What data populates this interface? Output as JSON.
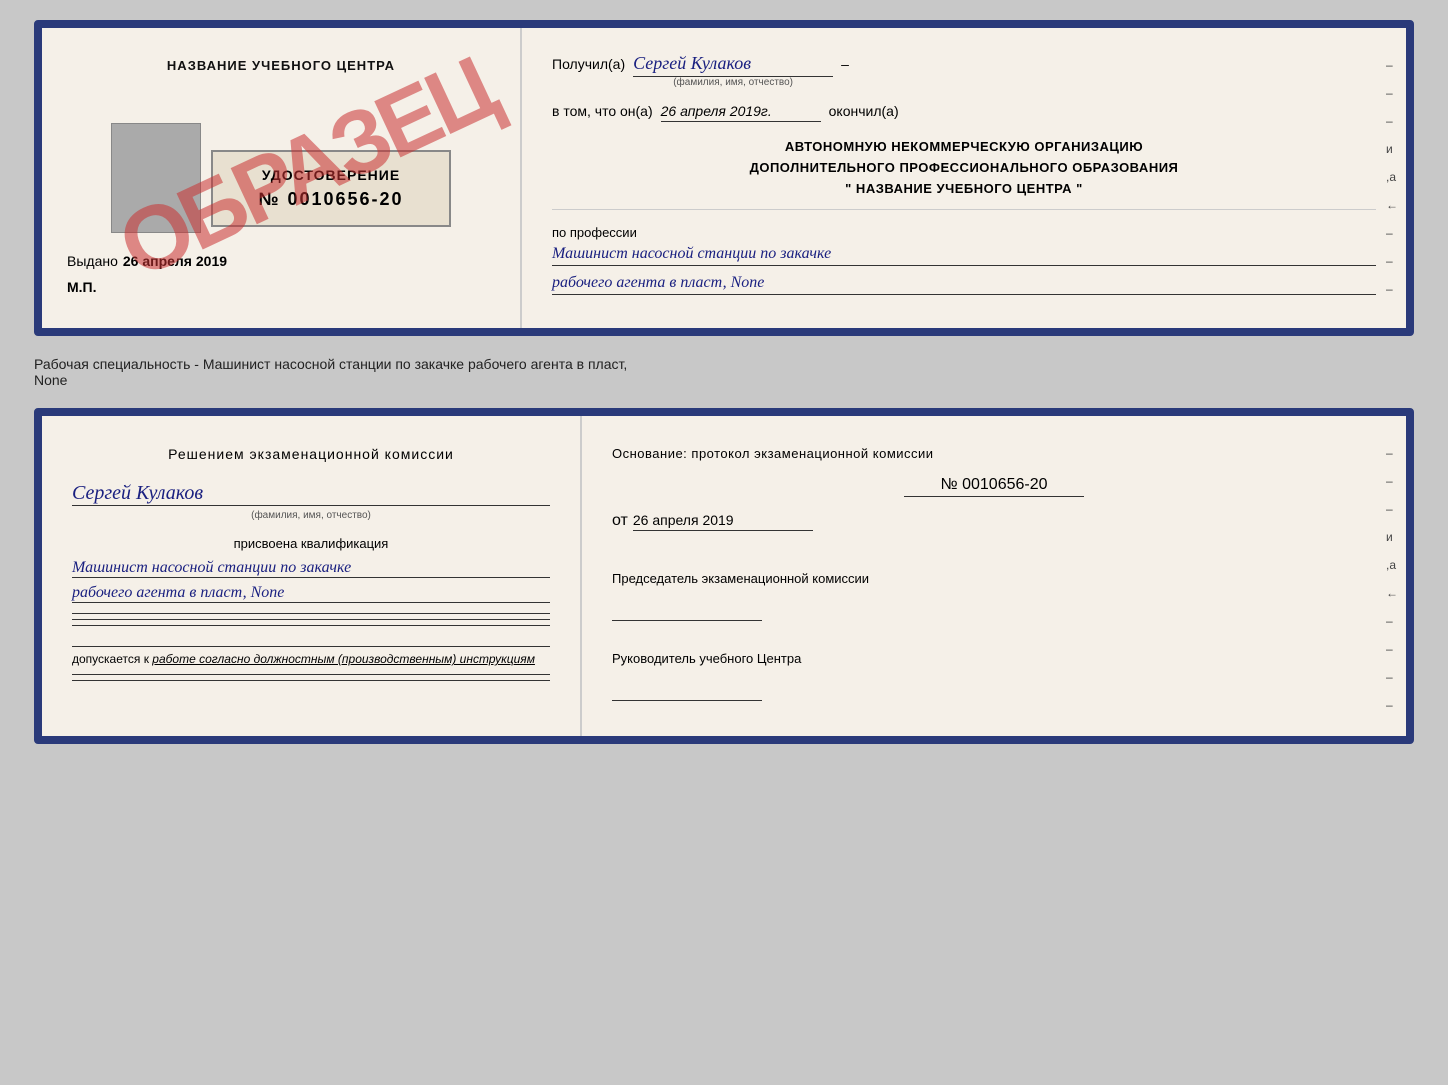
{
  "page": {
    "background": "#c8c8c8"
  },
  "card1": {
    "left": {
      "center_title": "НАЗВАНИЕ УЧЕБНОГО ЦЕНТРА",
      "stamp_text": "ОБРАЗЕЦ",
      "udost_label": "УДОСТОВЕРЕНИЕ",
      "udost_number": "№ 0010656-20",
      "vydano_label": "Выдано",
      "vydano_date": "26 апреля 2019",
      "mp_label": "М.П."
    },
    "right": {
      "poluchil_label": "Получил(а)",
      "poluchil_name": "Сергей Кулаков",
      "fio_hint": "(фамилия, имя, отчество)",
      "dash": "–",
      "vtom_label": "в том, что он(а)",
      "vtom_date": "26 апреля 2019г.",
      "okonchil_label": "окончил(а)",
      "org_line1": "АВТОНОМНУЮ НЕКОММЕРЧЕСКУЮ ОРГАНИЗАЦИЮ",
      "org_line2": "ДОПОЛНИТЕЛЬНОГО ПРОФЕССИОНАЛЬНОГО ОБРАЗОВАНИЯ",
      "org_line3": "\" НАЗВАНИЕ УЧЕБНОГО ЦЕНТРА \"",
      "prof_label": "по профессии",
      "prof_value1": "Машинист насосной станции по закачке",
      "prof_value2": "рабочего агента в пласт, None",
      "side_marks": [
        "-",
        "-",
        "-",
        "и",
        ",а",
        "←",
        "-",
        "-",
        "-"
      ]
    }
  },
  "description": {
    "text": "Рабочая специальность - Машинист насосной станции по закачке рабочего агента в пласт,",
    "text2": "None"
  },
  "card2": {
    "left": {
      "reshenie_title": "Решением экзаменационной комиссии",
      "cursive_name": "Сергей Кулаков",
      "fio_hint": "(фамилия, имя, отчество)",
      "prisvoyena_label": "присвоена квалификация",
      "qualif1": "Машинист насосной станции по закачке",
      "qualif2": "рабочего агента в пласт, None",
      "dopusk_label": "допускается к",
      "dopusk_value": "работе согласно должностным (производственным) инструкциям"
    },
    "right": {
      "osnov_title": "Основание: протокол экзаменационной комиссии",
      "protokol_number": "№ 0010656-20",
      "ot_label": "от",
      "ot_date": "26 апреля 2019",
      "predsedatel_label": "Председатель экзаменационной комиссии",
      "rukovod_label": "Руководитель учебного Центра",
      "side_marks": [
        "-",
        "-",
        "-",
        "–",
        "-",
        "и",
        ",а",
        "←",
        "-",
        "-",
        "-",
        "-"
      ]
    }
  }
}
